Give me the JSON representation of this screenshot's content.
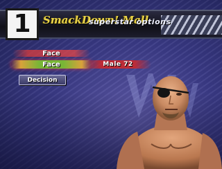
{
  "header": {
    "player_number": "1",
    "game_logo": "SmackDown! Mall",
    "title": "superstar options"
  },
  "menu": {
    "category_label": "Face",
    "edit_label": "Face",
    "edit_value": "Male 72",
    "decision_label": "Decision"
  },
  "colors": {
    "background": "#3a3a86",
    "highlight_red": "#d23a3a",
    "highlight_green": "#78b636",
    "logo_yellow": "#e8d24a"
  },
  "icons": {
    "emblem": "wwf-emblem",
    "wrestler": "wrestler-portrait"
  }
}
